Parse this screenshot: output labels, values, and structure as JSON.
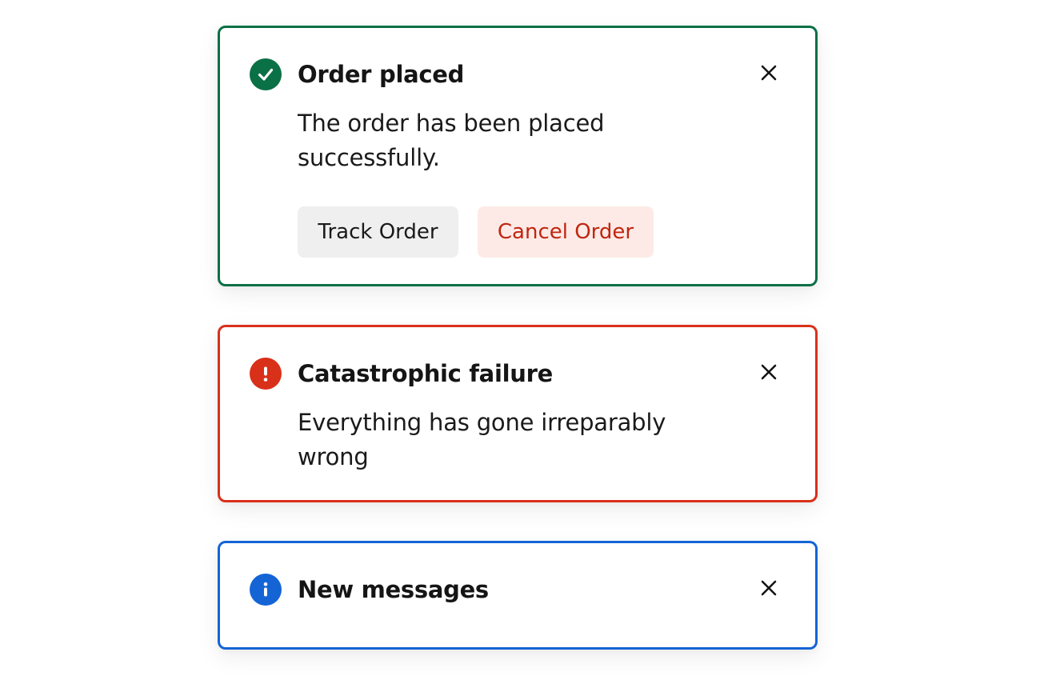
{
  "colors": {
    "success": "#0a7045",
    "error": "#d9301a",
    "info": "#1464d6",
    "neutral_button_bg": "#efefef",
    "danger_button_bg": "#fdeae7",
    "danger_button_text": "#c0260f"
  },
  "toasts": [
    {
      "variant": "success",
      "icon": "check-circle-icon",
      "title": "Order placed",
      "message": "The order has been placed successfully.",
      "close_icon": "close-icon",
      "actions": [
        {
          "label": "Track Order",
          "style": "neutral"
        },
        {
          "label": "Cancel Order",
          "style": "danger"
        }
      ]
    },
    {
      "variant": "error",
      "icon": "exclamation-circle-icon",
      "title": "Catastrophic failure",
      "message": "Everything has gone irreparably wrong",
      "close_icon": "close-icon"
    },
    {
      "variant": "info",
      "icon": "info-circle-icon",
      "title": "New messages",
      "close_icon": "close-icon"
    }
  ]
}
